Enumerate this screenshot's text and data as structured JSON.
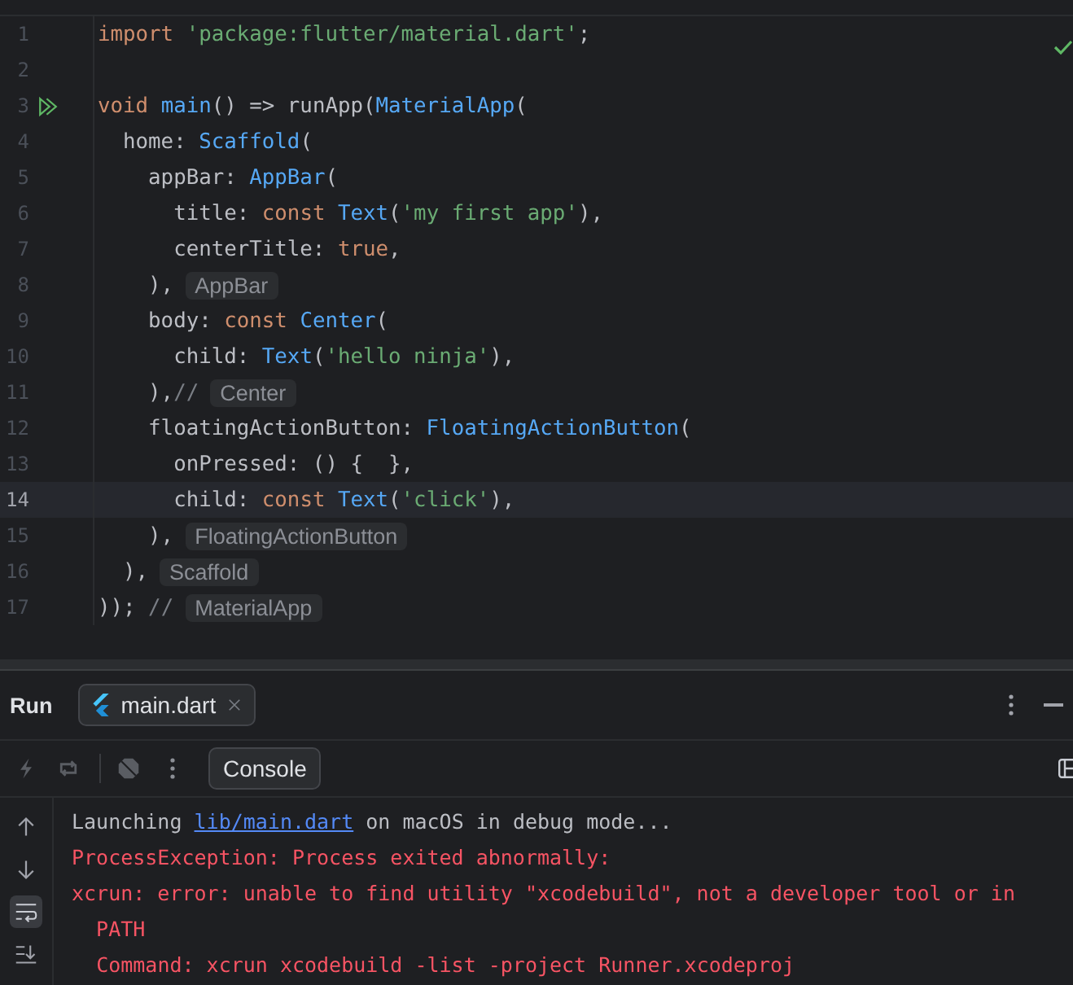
{
  "editor": {
    "lines": [
      {
        "number": "1",
        "run_marker": false,
        "current": false,
        "tokens": [
          {
            "kind": "keyword",
            "text": "import "
          },
          {
            "kind": "string",
            "text": "'package:flutter/material.dart'"
          },
          {
            "kind": "plain",
            "text": ";"
          }
        ]
      },
      {
        "number": "2",
        "run_marker": false,
        "current": false
      },
      {
        "number": "3",
        "run_marker": true,
        "current": false,
        "tokens": [
          {
            "kind": "keyword",
            "text": "void "
          },
          {
            "kind": "function",
            "text": "main"
          },
          {
            "kind": "plain",
            "text": "() => runApp("
          },
          {
            "kind": "class",
            "text": "MaterialApp"
          },
          {
            "kind": "plain",
            "text": "("
          }
        ]
      },
      {
        "number": "4",
        "run_marker": false,
        "current": false,
        "tokens": [
          {
            "kind": "plain",
            "text": "  home: "
          },
          {
            "kind": "class",
            "text": "Scaffold"
          },
          {
            "kind": "plain",
            "text": "("
          }
        ]
      },
      {
        "number": "5",
        "run_marker": false,
        "current": false,
        "tokens": [
          {
            "kind": "plain",
            "text": "    appBar: "
          },
          {
            "kind": "class",
            "text": "AppBar"
          },
          {
            "kind": "plain",
            "text": "("
          }
        ]
      },
      {
        "number": "6",
        "run_marker": false,
        "current": false,
        "tokens": [
          {
            "kind": "plain",
            "text": "      title: "
          },
          {
            "kind": "keyword",
            "text": "const "
          },
          {
            "kind": "class",
            "text": "Text"
          },
          {
            "kind": "plain",
            "text": "("
          },
          {
            "kind": "string",
            "text": "'my first app'"
          },
          {
            "kind": "plain",
            "text": "),"
          }
        ]
      },
      {
        "number": "7",
        "run_marker": false,
        "current": false,
        "tokens": [
          {
            "kind": "plain",
            "text": "      centerTitle: "
          },
          {
            "kind": "keyword",
            "text": "true"
          },
          {
            "kind": "plain",
            "text": ","
          }
        ]
      },
      {
        "number": "8",
        "run_marker": false,
        "current": false,
        "tokens": [
          {
            "kind": "plain",
            "text": "    ),"
          }
        ],
        "hint": "AppBar"
      },
      {
        "number": "9",
        "run_marker": false,
        "current": false,
        "tokens": [
          {
            "kind": "plain",
            "text": "    body: "
          },
          {
            "kind": "keyword",
            "text": "const "
          },
          {
            "kind": "class",
            "text": "Center"
          },
          {
            "kind": "plain",
            "text": "("
          }
        ]
      },
      {
        "number": "10",
        "run_marker": false,
        "current": false,
        "tokens": [
          {
            "kind": "plain",
            "text": "      child: "
          },
          {
            "kind": "class",
            "text": "Text"
          },
          {
            "kind": "plain",
            "text": "("
          },
          {
            "kind": "string",
            "text": "'hello ninja'"
          },
          {
            "kind": "plain",
            "text": "),"
          }
        ]
      },
      {
        "number": "11",
        "run_marker": false,
        "current": false,
        "tokens": [
          {
            "kind": "plain",
            "text": "    ),"
          },
          {
            "kind": "comment",
            "text": "//"
          }
        ],
        "hint": "Center"
      },
      {
        "number": "12",
        "run_marker": false,
        "current": false,
        "tokens": [
          {
            "kind": "plain",
            "text": "    floatingActionButton: "
          },
          {
            "kind": "class",
            "text": "FloatingActionButton"
          },
          {
            "kind": "plain",
            "text": "("
          }
        ]
      },
      {
        "number": "13",
        "run_marker": false,
        "current": false,
        "tokens": [
          {
            "kind": "plain",
            "text": "      onPressed: () {  },"
          }
        ]
      },
      {
        "number": "14",
        "run_marker": false,
        "current": true,
        "tokens": [
          {
            "kind": "plain",
            "text": "      child: "
          },
          {
            "kind": "keyword",
            "text": "const "
          },
          {
            "kind": "class",
            "text": "Text"
          },
          {
            "kind": "plain",
            "text": "("
          },
          {
            "kind": "string",
            "text": "'click'"
          },
          {
            "kind": "plain",
            "text": "),"
          }
        ]
      },
      {
        "number": "15",
        "run_marker": false,
        "current": false,
        "tokens": [
          {
            "kind": "plain",
            "text": "    ),"
          }
        ],
        "hint": "FloatingActionButton"
      },
      {
        "number": "16",
        "run_marker": false,
        "current": false,
        "tokens": [
          {
            "kind": "plain",
            "text": "  ),"
          }
        ],
        "hint": "Scaffold"
      },
      {
        "number": "17",
        "run_marker": false,
        "current": false,
        "tokens": [
          {
            "kind": "plain",
            "text": "));"
          },
          {
            "kind": "comment",
            "text": " //"
          }
        ],
        "hint": "MaterialApp"
      }
    ]
  },
  "run_panel": {
    "title": "Run",
    "tabs": [
      {
        "label": "main.dart",
        "selected": true
      }
    ],
    "console_tab": {
      "label": "Console",
      "selected": true
    },
    "soft_wrap_on": true,
    "console": [
      {
        "kind": "info",
        "text": "Launching ",
        "link": "lib/main.dart",
        "after": " on macOS in debug mode..."
      },
      {
        "kind": "error",
        "text": "ProcessException: Process exited abnormally:"
      },
      {
        "kind": "error",
        "text": "xcrun: error: unable to find utility \"xcodebuild\", not a developer tool or in PATH"
      },
      {
        "kind": "error",
        "text": "  Command: xcrun xcodebuild -list -project Runner.xcodeproj"
      }
    ]
  }
}
